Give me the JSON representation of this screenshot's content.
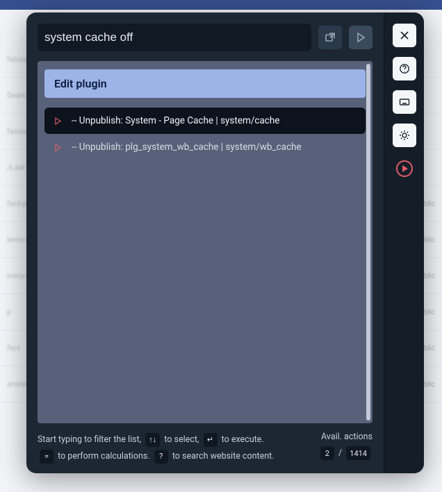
{
  "bg_rows": [
    {
      "l": "fature",
      "r": ""
    },
    {
      "l": "Search",
      "r": ""
    },
    {
      "l": "fassme",
      "r": ""
    },
    {
      "l": "/Last",
      "r": ""
    },
    {
      "l": "fard-polic",
      "r": "Public"
    },
    {
      "l": "lems-of-s",
      "r": "Public"
    },
    {
      "l": "ivacy-poli",
      "r": "Public"
    },
    {
      "l": "p",
      "r": "Public"
    },
    {
      "l": "fact",
      "r": "Public"
    },
    {
      "l": "anslations",
      "r": "Public"
    }
  ],
  "search": {
    "value": "system cache off"
  },
  "group_header": "Edit plugin",
  "results": [
    {
      "label": "-- Unpublish: System - Page Cache | system/cache",
      "active": true
    },
    {
      "label": "-- Unpublish: plg_system_wb_cache | system/wb_cache",
      "active": false
    }
  ],
  "hints": {
    "l1a": "Start typing to filter the list,",
    "k1": "↑↓",
    "l1b": "to select,",
    "k2": "↵",
    "l1c": "to execute.",
    "k3": "=",
    "l2a": "to perform calculations.",
    "k4": "?",
    "l2b": "to search website content."
  },
  "avail": {
    "label": "Avail. actions",
    "current": "2",
    "sep": "/",
    "total": "1414"
  }
}
